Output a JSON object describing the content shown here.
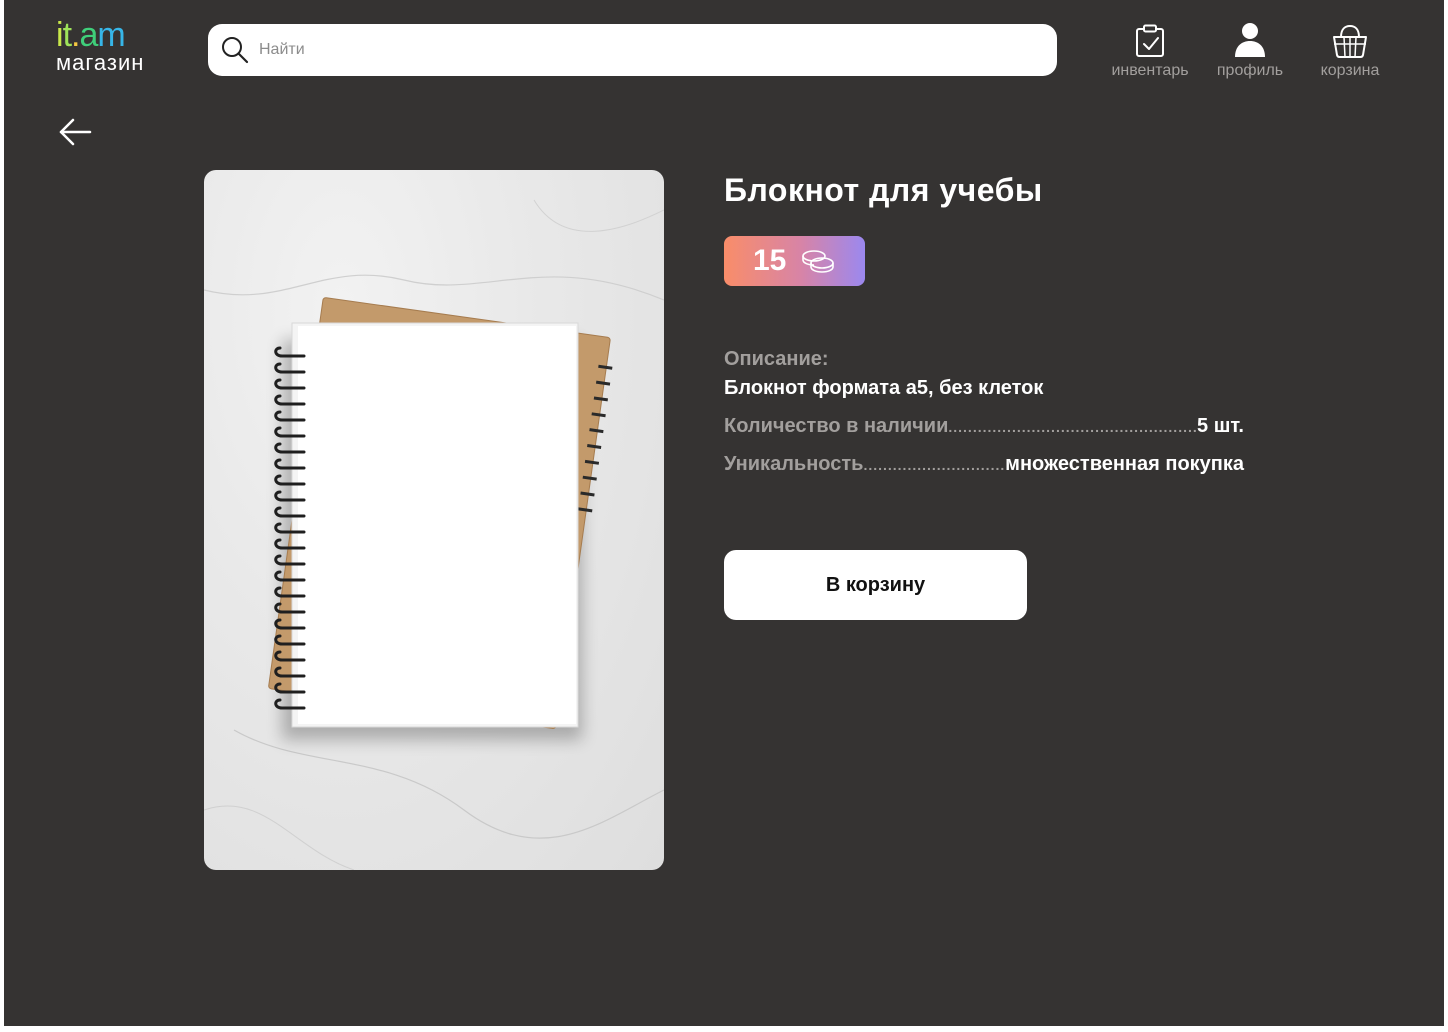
{
  "logo": {
    "top_letters": [
      "i",
      "t",
      ".",
      "a",
      "m"
    ],
    "top_colors": [
      "#c9e84a",
      "#9ee35a",
      "#f5c842",
      "#3fcf7a",
      "#37b6e8"
    ],
    "subtitle": "магазин"
  },
  "search": {
    "placeholder": "Найти",
    "value": ""
  },
  "nav": {
    "inventory": {
      "label": "инвентарь",
      "icon": "clipboard-check-icon"
    },
    "profile": {
      "label": "профиль",
      "icon": "user-icon"
    },
    "cart": {
      "label": "корзина",
      "icon": "basket-icon"
    }
  },
  "product": {
    "title": "Блокнот для учебы",
    "price": "15",
    "price_icon": "coins-icon",
    "description_label": "Описание:",
    "description": "Блокнот формата а5, без клеток",
    "stock_label": "Количество в наличии",
    "stock_value": "5 шт.",
    "uniqueness_label": "Уникальность",
    "uniqueness_value": "множественная покупка",
    "add_to_cart_label": "В корзину"
  },
  "colors": {
    "background": "#353332",
    "muted_text": "#a29f9d",
    "badge_gradient": [
      "#f98d69",
      "#d784a7",
      "#9b88ef"
    ]
  }
}
